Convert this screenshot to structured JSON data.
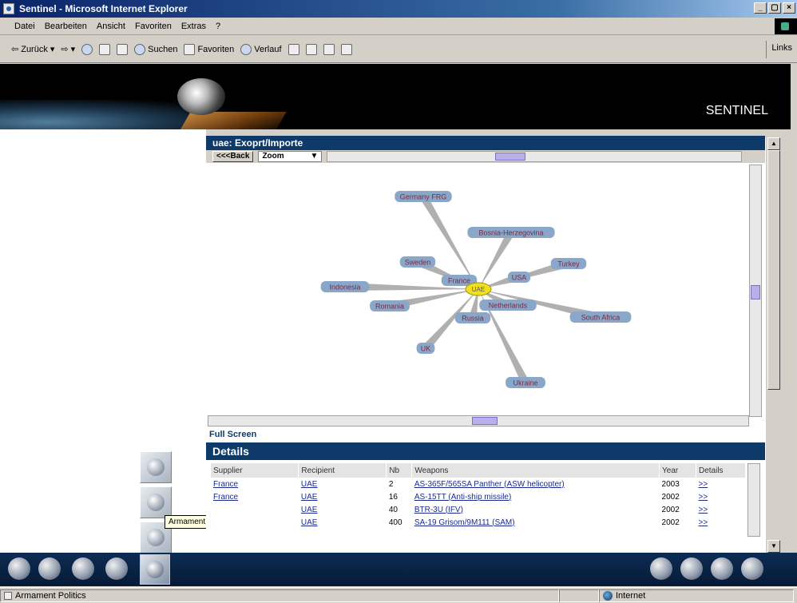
{
  "window": {
    "title": "Sentinel - Microsoft Internet Explorer",
    "buttons": [
      "_",
      "×"
    ]
  },
  "menu": [
    "Datei",
    "Bearbeiten",
    "Ansicht",
    "Favoriten",
    "Extras",
    "?"
  ],
  "toolbar": {
    "back": "Zurück",
    "search": "Suchen",
    "favorites": "Favoriten",
    "history": "Verlauf",
    "links": "Links"
  },
  "banner": {
    "brand": "SENTINEL"
  },
  "panel": {
    "title": "uae: Exoprt/Importe",
    "back_button": "<<<Back",
    "zoom_select": "Zoom",
    "full_screen": "Full Screen"
  },
  "graph": {
    "center": "UAE",
    "nodes": [
      "Germany FRG",
      "Bosnia-Herzegovina",
      "Sweden",
      "France",
      "USA",
      "Turkey",
      "Indonesia",
      "Netherlands",
      "Romania",
      "Russia",
      "South Africa",
      "UK",
      "Ukraine"
    ],
    "edge_color": "#b0b0b0",
    "node_fill": "#8aa6c8",
    "center_fill": "#f0e020"
  },
  "details": {
    "title": "Details",
    "columns": [
      "Supplier",
      "Recipient",
      "Nb",
      "Weapons",
      "Year",
      "Details"
    ],
    "rows": [
      {
        "supplier": "France",
        "recipient": "UAE",
        "nb": "2",
        "weapons": "AS-365F/565SA Panther (ASW helicopter)",
        "year": "2003",
        "details": ">>"
      },
      {
        "supplier": "France",
        "recipient": "UAE",
        "nb": "16",
        "weapons": "AS-15TT (Anti-ship missile)",
        "year": "2002",
        "details": ">>"
      },
      {
        "supplier": "",
        "recipient": "UAE",
        "nb": "40",
        "weapons": "BTR-3U (IFV)",
        "year": "2002",
        "details": ">>"
      },
      {
        "supplier": "",
        "recipient": "UAE",
        "nb": "400",
        "weapons": "SA-19 Grisom/9M111 (SAM)",
        "year": "2002",
        "details": ">>"
      }
    ]
  },
  "side_tooltip": "Armament Politics",
  "status": {
    "text": "Armament Politics",
    "zone": "Internet"
  },
  "colors": {
    "header_bg": "#0e3a6a",
    "link": "#1a2b8c"
  }
}
